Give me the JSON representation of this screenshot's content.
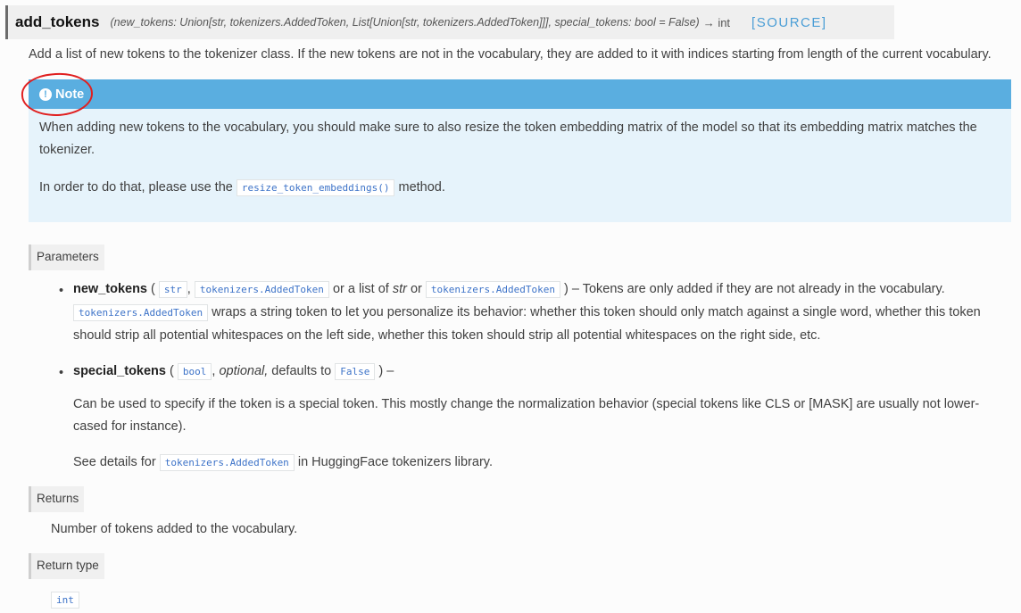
{
  "signature": {
    "name": "add_tokens",
    "params": "(new_tokens: Union[str, tokenizers.AddedToken, List[Union[str, tokenizers.AddedToken]]], special_tokens: bool = False)",
    "return_arrow": "→ int",
    "source_link": "[SOURCE]"
  },
  "description": "Add a list of new tokens to the tokenizer class. If the new tokens are not in the vocabulary, they are added to it with indices starting from length of the current vocabulary.",
  "note": {
    "title": "Note",
    "para1": "When adding new tokens to the vocabulary, you should make sure to also resize the token embedding matrix of the model so that its embedding matrix matches the tokenizer.",
    "para2_prefix": "In order to do that, please use the",
    "para2_code": "resize_token_embeddings()",
    "para2_suffix": "method."
  },
  "parameters": {
    "label": "Parameters",
    "new_tokens": {
      "name": "new_tokens",
      "open": " (",
      "type1": "str",
      "comma": ",",
      "type2": "tokenizers.AddedToken",
      "or_list": "or a list of",
      "type3_italic": "str",
      "or": "or",
      "type4": "tokenizers.AddedToken",
      "close_desc": ") – Tokens are only added if they are not already in the vocabulary.",
      "line2_code": "tokenizers.AddedToken",
      "line2_text": "wraps a string token to let you personalize its behavior: whether this token should only match against a single word, whether this token",
      "line3_text": "should strip all potential whitespaces on the left side, whether this token should strip all potential whitespaces on the right side, etc."
    },
    "special_tokens": {
      "name": "special_tokens",
      "open": " (",
      "type1": "bool",
      "optional": "optional,",
      "defaults": "defaults to",
      "default_value": "False",
      "close": ") –",
      "desc_line1": "Can be used to specify if the token is a special token. This mostly change the normalization behavior (special tokens like CLS or [MASK] are usually not lower-",
      "desc_line2": "cased for instance).",
      "see_prefix": "See details for",
      "see_code": "tokenizers.AddedToken",
      "see_suffix": "in HuggingFace tokenizers library."
    }
  },
  "returns": {
    "label": "Returns",
    "text": "Number of tokens added to the vocabulary."
  },
  "return_type": {
    "label": "Return type",
    "value": "int"
  }
}
